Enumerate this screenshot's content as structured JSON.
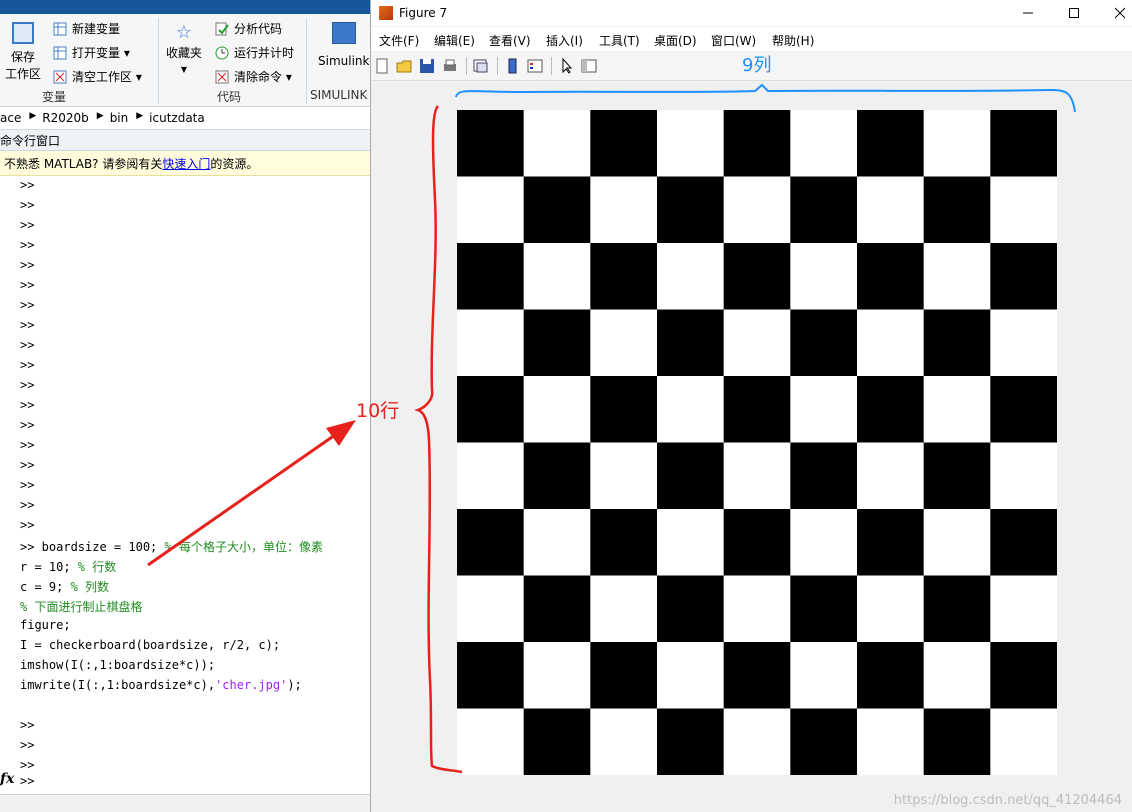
{
  "ribbon": {
    "save": {
      "line1": "保存",
      "line2": "工作区"
    },
    "new_var": "新建变量",
    "open_var": "打开变量 ▾",
    "clear_ws": "清空工作区 ▾",
    "group_variable": "变量",
    "favorites": "收藏夹",
    "analyze": "分析代码",
    "run_time": "运行并计时",
    "clear_cmd": "清除命令 ▾",
    "group_code": "代码",
    "simulink": "Simulink",
    "group_simulink": "SIMULINK"
  },
  "path": [
    "ace",
    "R2020b",
    "bin",
    "icutzdata"
  ],
  "cmd_window": {
    "title": "命令行窗口",
    "notice_prefix": "不熟悉 MATLAB? 请参阅有关",
    "notice_link": "快速入门",
    "notice_suffix": "的资源。",
    "empty_prompt_count": 18,
    "prompt": ">>",
    "code": [
      {
        "pre": ">> boardsize = 100; ",
        "comment": "% 每个格子大小，单位：像素"
      },
      {
        "pre": "r = 10; ",
        "comment": "% 行数"
      },
      {
        "pre": "c = 9; ",
        "comment": "% 列数"
      },
      {
        "pre": "",
        "comment": "% 下面进行制止棋盘格"
      },
      {
        "pre": "figure;",
        "comment": ""
      },
      {
        "pre": "I = checkerboard(boardsize, r/2, c);",
        "comment": ""
      },
      {
        "pre": "imshow(I(:,1:boardsize*c));",
        "comment": ""
      },
      {
        "pre": "imwrite(I(:,1:boardsize*c),",
        "str": "'cher.jpg'",
        "post": ");"
      }
    ],
    "trailing_prompts": [
      ">>",
      ">>",
      ">>"
    ],
    "fx": "fx",
    "fx_prompt": ">>"
  },
  "figure": {
    "title": "Figure 7",
    "menu": [
      "文件(F)",
      "编辑(E)",
      "查看(V)",
      "插入(I)",
      "工具(T)",
      "桌面(D)",
      "窗口(W)",
      "帮助(H)"
    ],
    "toolbar_icons": [
      "new-icon",
      "open-icon",
      "save-icon",
      "print-icon",
      "link-icon",
      "colorbar-icon",
      "legend-icon",
      "pointer-icon",
      "property-icon"
    ],
    "board": {
      "rows": 10,
      "cols": 9,
      "dark": "#000000",
      "light": "#ffffff"
    }
  },
  "annotations": {
    "cols_label": "9列",
    "rows_label": "10行",
    "blue": "#1e90ff",
    "red": "#e8201c"
  },
  "watermark": "https://blog.csdn.net/qq_41204464"
}
